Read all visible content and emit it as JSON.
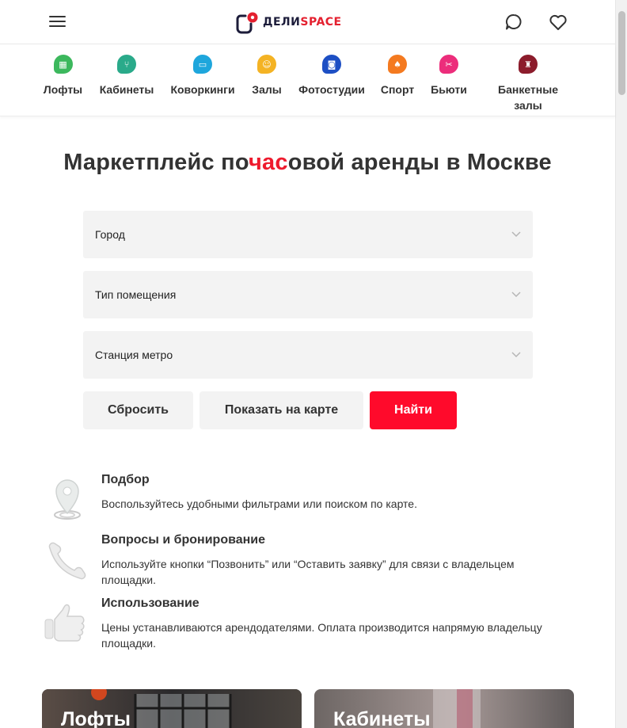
{
  "header": {
    "logo_part1": "ДЕЛИ",
    "logo_part2": "SPACE",
    "menu_icon": "hamburger-menu-icon",
    "chat_icon": "chat-bubble-icon",
    "favorites_icon": "heart-icon"
  },
  "categories": [
    {
      "label": "Лофты",
      "color": "#3cb85d",
      "icon": "loft-icon"
    },
    {
      "label": "Кабинеты",
      "color": "#2aaa8a",
      "icon": "office-chair-icon"
    },
    {
      "label": "Коворкинги",
      "color": "#1ea6dc",
      "icon": "laptop-icon"
    },
    {
      "label": "Залы",
      "color": "#f4b324",
      "icon": "hall-icon"
    },
    {
      "label": "Фотостудии",
      "color": "#1d4fc4",
      "icon": "camera-icon"
    },
    {
      "label": "Спорт",
      "color": "#f47a20",
      "icon": "running-icon"
    },
    {
      "label": "Бьюти",
      "color": "#ec2d7b",
      "icon": "scissors-icon"
    },
    {
      "label": "Банкетные залы",
      "color": "#8c1c2c",
      "icon": "wine-glass-icon"
    }
  ],
  "hero": {
    "title_before": "Маркетплейс по",
    "title_highlight": "час",
    "title_after": "овой аренды в Москве"
  },
  "filters": {
    "city": "Город",
    "room_type": "Тип помещения",
    "metro": "Станция метро"
  },
  "buttons": {
    "reset": "Сбросить",
    "show_on_map": "Показать на карте",
    "find": "Найти"
  },
  "steps": [
    {
      "title": "Подбор",
      "desc": "Воспользуйтесь удобными фильтрами или поиском по карте.",
      "icon": "map-pin-icon"
    },
    {
      "title": "Вопросы и бронирование",
      "desc": "Используйте кнопки “Позвонить” или “Оставить заявку” для связи с владельцем площадки.",
      "icon": "phone-handset-icon"
    },
    {
      "title": "Использование",
      "desc": "Цены устанавливаются арендодателями. Оплата производится напрямую владельцу площадки.",
      "icon": "thumbs-up-icon"
    }
  ],
  "cards": [
    {
      "label": "Лофты"
    },
    {
      "label": "Кабинеты"
    }
  ],
  "colors": {
    "accent": "#ff0a2b",
    "title_highlight": "#ee1b2e",
    "field_bg": "#f3f3f3"
  }
}
